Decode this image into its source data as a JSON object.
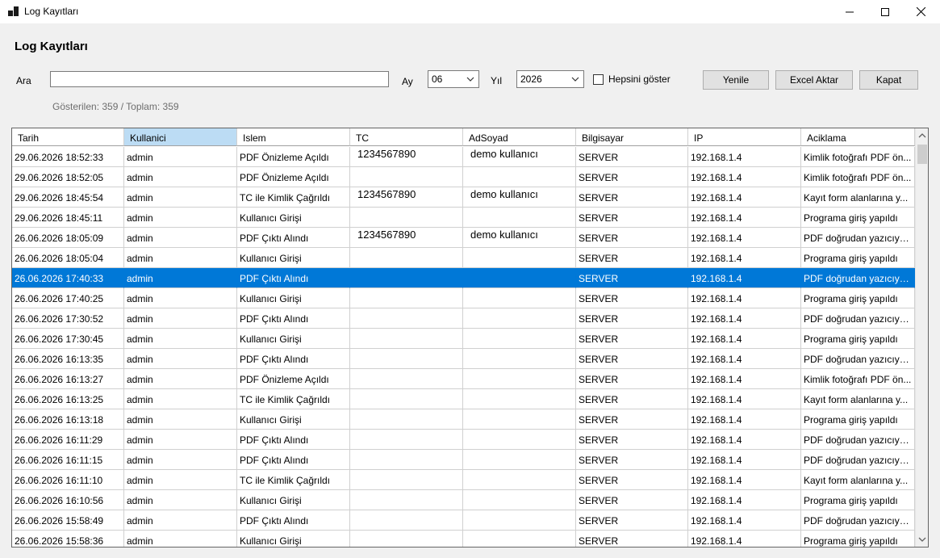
{
  "window": {
    "title": "Log Kayıtları",
    "icons": {
      "app": "app-window-icon",
      "minimize": "minimize-icon",
      "maximize": "maximize-icon",
      "close": "close-icon"
    }
  },
  "header": {
    "title": "Log Kayıtları"
  },
  "filters": {
    "search_label": "Ara",
    "search_value": "",
    "search_placeholder": "",
    "month_label": "Ay",
    "month_value": "06",
    "year_label": "Yıl",
    "year_value": "2026",
    "show_all_label": "Hepsini göster",
    "show_all_checked": false
  },
  "buttons": {
    "refresh": "Yenile",
    "export": "Excel Aktar",
    "close": "Kapat"
  },
  "status": {
    "count_text": "Gösterilen: 359 / Toplam: 359"
  },
  "grid": {
    "columns": [
      "Tarih",
      "Kullanici",
      "Islem",
      "TC",
      "AdSoyad",
      "Bilgisayar",
      "IP",
      "Aciklama"
    ],
    "selected_header": "Kullanici",
    "selected_row_index": 6,
    "colors": {
      "selection": "#0078d7",
      "header_selection": "#bcdcf4"
    },
    "rows": [
      [
        "29.06.2026 18:52:33",
        "admin",
        "PDF Önizleme Açıldı",
        "1234567890",
        "demo kullanıcı",
        "SERVER",
        "192.168.1.4",
        "Kimlik fotoğrafı PDF ön..."
      ],
      [
        "29.06.2026 18:52:05",
        "admin",
        "PDF Önizleme Açıldı",
        "",
        "",
        "SERVER",
        "192.168.1.4",
        "Kimlik fotoğrafı PDF ön..."
      ],
      [
        "29.06.2026 18:45:54",
        "admin",
        "TC ile Kimlik Çağrıldı",
        "1234567890",
        "demo kullanıcı",
        "SERVER",
        "192.168.1.4",
        "Kayıt form alanlarına y..."
      ],
      [
        "29.06.2026 18:45:11",
        "admin",
        "Kullanıcı Girişi",
        "",
        "",
        "SERVER",
        "192.168.1.4",
        "Programa giriş yapıldı"
      ],
      [
        "26.06.2026 18:05:09",
        "admin",
        "PDF Çıktı Alındı",
        "1234567890",
        "demo kullanıcı",
        "SERVER",
        "192.168.1.4",
        "PDF doğrudan yazıcıya ..."
      ],
      [
        "26.06.2026 18:05:04",
        "admin",
        "Kullanıcı Girişi",
        "",
        "",
        "SERVER",
        "192.168.1.4",
        "Programa giriş yapıldı"
      ],
      [
        "26.06.2026 17:40:33",
        "admin",
        "PDF Çıktı Alındı",
        "",
        "",
        "SERVER",
        "192.168.1.4",
        "PDF doğrudan yazıcıya ..."
      ],
      [
        "26.06.2026 17:40:25",
        "admin",
        "Kullanıcı Girişi",
        "",
        "",
        "SERVER",
        "192.168.1.4",
        "Programa giriş yapıldı"
      ],
      [
        "26.06.2026 17:30:52",
        "admin",
        "PDF Çıktı Alındı",
        "",
        "",
        "SERVER",
        "192.168.1.4",
        "PDF doğrudan yazıcıya ..."
      ],
      [
        "26.06.2026 17:30:45",
        "admin",
        "Kullanıcı Girişi",
        "",
        "",
        "SERVER",
        "192.168.1.4",
        "Programa giriş yapıldı"
      ],
      [
        "26.06.2026 16:13:35",
        "admin",
        "PDF Çıktı Alındı",
        "",
        "",
        "SERVER",
        "192.168.1.4",
        "PDF doğrudan yazıcıya ..."
      ],
      [
        "26.06.2026 16:13:27",
        "admin",
        "PDF Önizleme Açıldı",
        "",
        "",
        "SERVER",
        "192.168.1.4",
        "Kimlik fotoğrafı PDF ön..."
      ],
      [
        "26.06.2026 16:13:25",
        "admin",
        "TC ile Kimlik Çağrıldı",
        "",
        "",
        "SERVER",
        "192.168.1.4",
        "Kayıt form alanlarına y..."
      ],
      [
        "26.06.2026 16:13:18",
        "admin",
        "Kullanıcı Girişi",
        "",
        "",
        "SERVER",
        "192.168.1.4",
        "Programa giriş yapıldı"
      ],
      [
        "26.06.2026 16:11:29",
        "admin",
        "PDF Çıktı Alındı",
        "",
        "",
        "SERVER",
        "192.168.1.4",
        "PDF doğrudan yazıcıya ..."
      ],
      [
        "26.06.2026 16:11:15",
        "admin",
        "PDF Çıktı Alındı",
        "",
        "",
        "SERVER",
        "192.168.1.4",
        "PDF doğrudan yazıcıya ..."
      ],
      [
        "26.06.2026 16:11:10",
        "admin",
        "TC ile Kimlik Çağrıldı",
        "",
        "",
        "SERVER",
        "192.168.1.4",
        "Kayıt form alanlarına y..."
      ],
      [
        "26.06.2026 16:10:56",
        "admin",
        "Kullanıcı Girişi",
        "",
        "",
        "SERVER",
        "192.168.1.4",
        "Programa giriş yapıldı"
      ],
      [
        "26.06.2026 15:58:49",
        "admin",
        "PDF Çıktı Alındı",
        "",
        "",
        "SERVER",
        "192.168.1.4",
        "PDF doğrudan yazıcıya ..."
      ],
      [
        "26.06.2026 15:58:36",
        "admin",
        "Kullanıcı Girişi",
        "",
        "",
        "SERVER",
        "192.168.1.4",
        "Programa giriş yapıldı"
      ]
    ]
  }
}
